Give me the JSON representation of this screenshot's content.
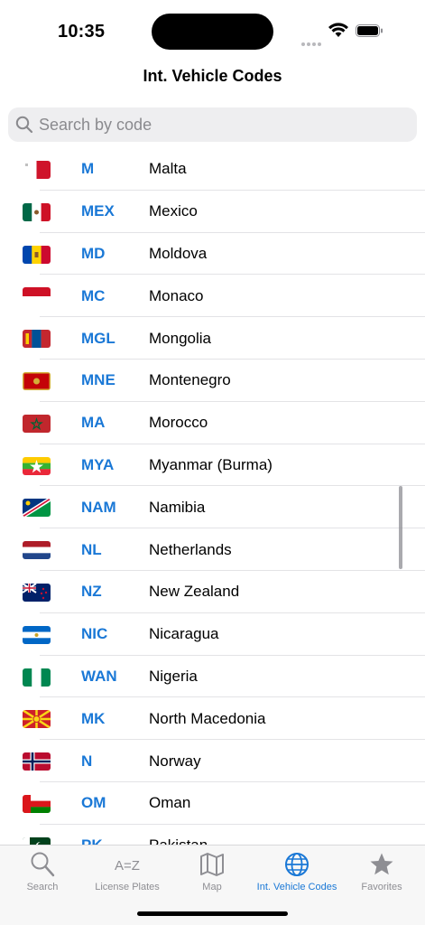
{
  "status_bar": {
    "time": "10:35"
  },
  "nav": {
    "title": "Int. Vehicle Codes"
  },
  "search": {
    "placeholder": "Search by code"
  },
  "rows": [
    {
      "code": "M",
      "country": "Malta",
      "flag": "malta"
    },
    {
      "code": "MEX",
      "country": "Mexico",
      "flag": "mexico"
    },
    {
      "code": "MD",
      "country": "Moldova",
      "flag": "moldova"
    },
    {
      "code": "MC",
      "country": "Monaco",
      "flag": "monaco"
    },
    {
      "code": "MGL",
      "country": "Mongolia",
      "flag": "mongolia"
    },
    {
      "code": "MNE",
      "country": "Montenegro",
      "flag": "montenegro"
    },
    {
      "code": "MA",
      "country": "Morocco",
      "flag": "morocco"
    },
    {
      "code": "MYA",
      "country": "Myanmar (Burma)",
      "flag": "myanmar"
    },
    {
      "code": "NAM",
      "country": "Namibia",
      "flag": "namibia"
    },
    {
      "code": "NL",
      "country": "Netherlands",
      "flag": "netherlands"
    },
    {
      "code": "NZ",
      "country": "New Zealand",
      "flag": "new-zealand"
    },
    {
      "code": "NIC",
      "country": "Nicaragua",
      "flag": "nicaragua"
    },
    {
      "code": "WAN",
      "country": "Nigeria",
      "flag": "nigeria"
    },
    {
      "code": "MK",
      "country": "North Macedonia",
      "flag": "north-macedonia"
    },
    {
      "code": "N",
      "country": "Norway",
      "flag": "norway"
    },
    {
      "code": "OM",
      "country": "Oman",
      "flag": "oman"
    },
    {
      "code": "PK",
      "country": "Pakistan",
      "flag": "pakistan"
    }
  ],
  "tabs": [
    {
      "label": "Search",
      "icon": "magnifier-icon",
      "active": false
    },
    {
      "label": "License Plates",
      "icon": "a-z-icon",
      "active": false
    },
    {
      "label": "Map",
      "icon": "map-icon",
      "active": false
    },
    {
      "label": "Int. Vehicle Codes",
      "icon": "globe-icon",
      "active": true
    },
    {
      "label": "Favorites",
      "icon": "star-icon",
      "active": false
    }
  ],
  "colors": {
    "accent": "#1a78d6",
    "inactive": "#8e8e93"
  }
}
